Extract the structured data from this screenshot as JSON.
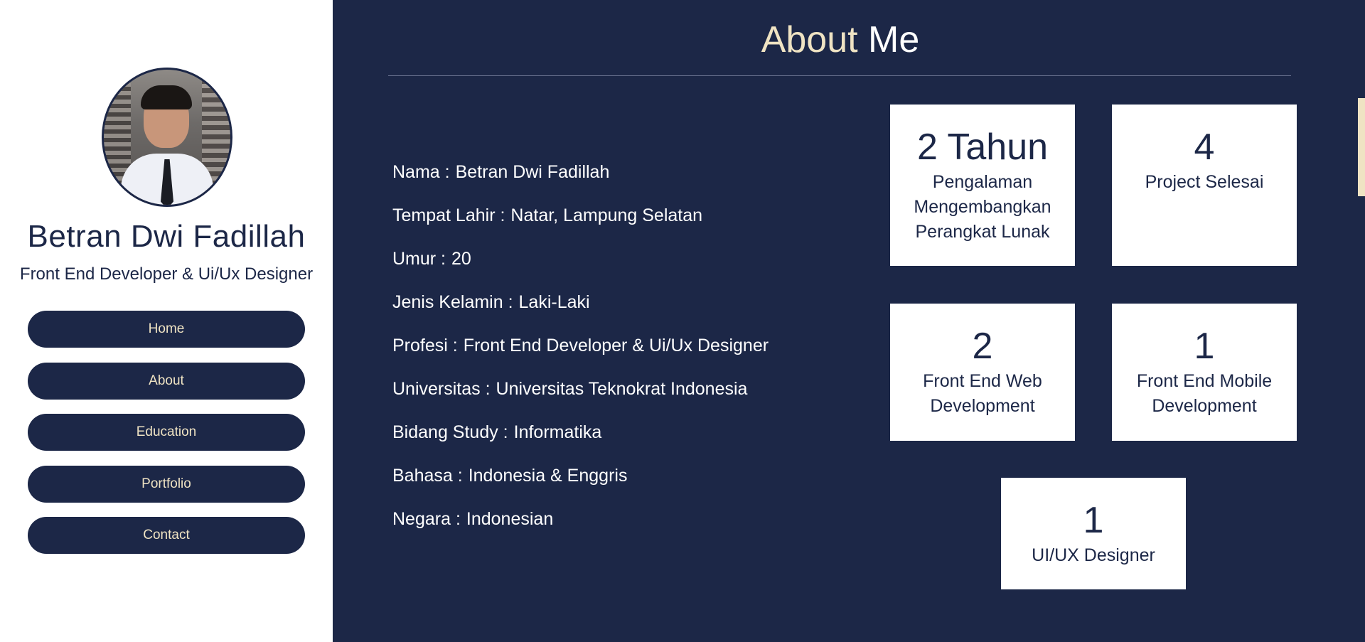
{
  "profile": {
    "name": "Betran Dwi Fadillah",
    "role": "Front End Developer & Ui/Ux Designer"
  },
  "nav": {
    "items": [
      {
        "label": "Home"
      },
      {
        "label": "About"
      },
      {
        "label": "Education"
      },
      {
        "label": "Portfolio"
      },
      {
        "label": "Contact"
      }
    ]
  },
  "about": {
    "title_part1": "About",
    "title_part2": "Me",
    "info": [
      {
        "label": "Nama :",
        "value": "Betran Dwi Fadillah"
      },
      {
        "label": "Tempat Lahir :",
        "value": "Natar, Lampung Selatan"
      },
      {
        "label": "Umur :",
        "value": "20"
      },
      {
        "label": "Jenis Kelamin :",
        "value": "Laki-Laki"
      },
      {
        "label": "Profesi :",
        "value": "Front End Developer & Ui/Ux Designer"
      },
      {
        "label": "Universitas :",
        "value": "Universitas Teknokrat Indonesia"
      },
      {
        "label": "Bidang Study :",
        "value": "Informatika"
      },
      {
        "label": "Bahasa :",
        "value": "Indonesia & Enggris"
      },
      {
        "label": "Negara :",
        "value": "Indonesian"
      }
    ],
    "stats": [
      {
        "number": "2 Tahun",
        "label_lines": [
          "Pengalaman",
          "Mengembangkan",
          "Perangkat Lunak"
        ]
      },
      {
        "number": "4",
        "label_lines": [
          "Project Selesai"
        ]
      },
      {
        "number": "2",
        "label_lines": [
          "Front End Web",
          "Development"
        ]
      },
      {
        "number": "1",
        "label_lines": [
          "Front End Mobile",
          "Development"
        ]
      },
      {
        "number": "1",
        "label_lines": [
          "UI/UX Designer"
        ]
      }
    ]
  },
  "colors": {
    "navy": "#1c2747",
    "cream": "#efe3c3",
    "white": "#ffffff"
  }
}
